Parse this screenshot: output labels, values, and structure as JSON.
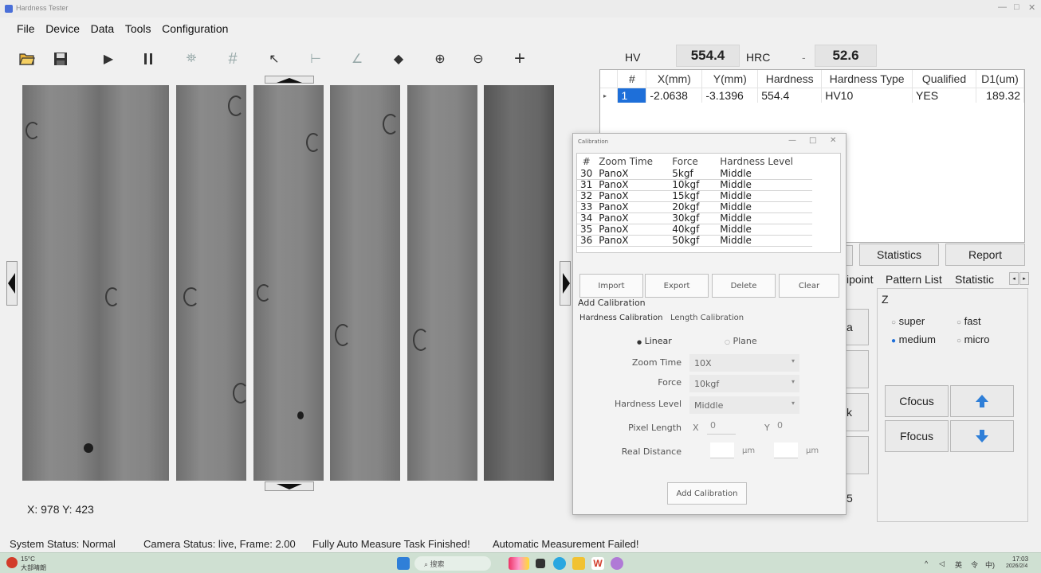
{
  "window": {
    "title": "Hardness Tester",
    "controls": [
      "—",
      "□",
      "✕"
    ]
  },
  "menu": [
    "File",
    "Device",
    "Data",
    "Tools",
    "Configuration"
  ],
  "toolbar": {
    "icons": [
      "open-folder-icon",
      "save-icon",
      "play-icon",
      "pause-icon",
      "auto-detect-icon",
      "grid-icon",
      "pointer-icon",
      "length-icon",
      "angle-icon",
      "eraser-icon",
      "zoom-in-icon",
      "zoom-out-icon",
      "crosshair-icon"
    ],
    "glyphs": [
      "📂",
      "💾",
      "▶",
      "⏸",
      "⛯",
      "#",
      "↖",
      "⊢",
      "∠",
      "◆",
      "⊕",
      "⊖",
      "+"
    ]
  },
  "readings": {
    "hv_label": "HV",
    "hv_value": "554.4",
    "hrc_label": "HRC",
    "hrc_sep": "-",
    "hrc_value": "52.6"
  },
  "results": {
    "columns": [
      "#",
      "X(mm)",
      "Y(mm)",
      "Hardness",
      "Hardness Type",
      "Qualified",
      "D1(um)"
    ],
    "rows": [
      {
        "marker": "▸",
        "n": "1",
        "x": "-2.0638",
        "y": "-3.1396",
        "hardness": "554.4",
        "type": "HV10",
        "qualified": "YES",
        "d1": "189.32"
      }
    ]
  },
  "right_panel": {
    "statistics_button": "Statistics",
    "report_button": "Report",
    "tabs": [
      "ipoint",
      "Pattern List",
      "Statistic"
    ],
    "z_label": "Z",
    "speed_options": [
      {
        "label": "super",
        "selected": false
      },
      {
        "label": "fast",
        "selected": false
      },
      {
        "label": "medium",
        "selected": true
      },
      {
        "label": "micro",
        "selected": false
      }
    ],
    "cfocus_button": "Cfocus",
    "ffocus_button": "Ffocus",
    "partial": [
      "a",
      "k",
      "5"
    ]
  },
  "calibration": {
    "title": "Calibration",
    "columns": [
      "#",
      "Zoom Time",
      "Force",
      "Hardness Level"
    ],
    "rows": [
      {
        "n": "30",
        "zoom": "PanoX",
        "force": "5kgf",
        "level": "Middle"
      },
      {
        "n": "31",
        "zoom": "PanoX",
        "force": "10kgf",
        "level": "Middle"
      },
      {
        "n": "32",
        "zoom": "PanoX",
        "force": "15kgf",
        "level": "Middle"
      },
      {
        "n": "33",
        "zoom": "PanoX",
        "force": "20kgf",
        "level": "Middle"
      },
      {
        "n": "34",
        "zoom": "PanoX",
        "force": "30kgf",
        "level": "Middle"
      },
      {
        "n": "35",
        "zoom": "PanoX",
        "force": "40kgf",
        "level": "Middle"
      },
      {
        "n": "36",
        "zoom": "PanoX",
        "force": "50kgf",
        "level": "Middle"
      }
    ],
    "buttons": {
      "import": "Import",
      "export": "Export",
      "delete": "Delete",
      "clear": "Clear"
    },
    "section": "Add Calibration",
    "tabs": [
      "Hardness Calibration",
      "Length Calibration"
    ],
    "mode_linear": "Linear",
    "mode_plane": "Plane",
    "zoom_label": "Zoom Time",
    "zoom_value": "10X",
    "force_label": "Force",
    "force_value": "10kgf",
    "level_label": "Hardness Level",
    "level_value": "Middle",
    "pixel_label": "Pixel Length",
    "x_label": "X",
    "x_value": "0",
    "y_label": "Y",
    "y_value": "0",
    "real_label": "Real Distance",
    "unit": "μm",
    "add_button": "Add Calibration"
  },
  "coords": "X:  978   Y:  423",
  "status": {
    "system": "System Status: Normal",
    "camera": "Camera Status: live, Frame: 2.00",
    "task": "Fully Auto Measure Task Finished!",
    "result": "Automatic Measurement Failed!"
  },
  "taskbar": {
    "weather_temp": "15°C",
    "weather_desc": "大部晴朗",
    "search": "搜索",
    "tray": [
      "^",
      "◁",
      "英",
      "令",
      "中)"
    ],
    "time": "17:03",
    "date": "2026/2/4"
  },
  "colors": {
    "accent_blue": "#2f7fd8",
    "selected_row": "#1e6fd9",
    "taskbar": "#cfe0d2"
  }
}
